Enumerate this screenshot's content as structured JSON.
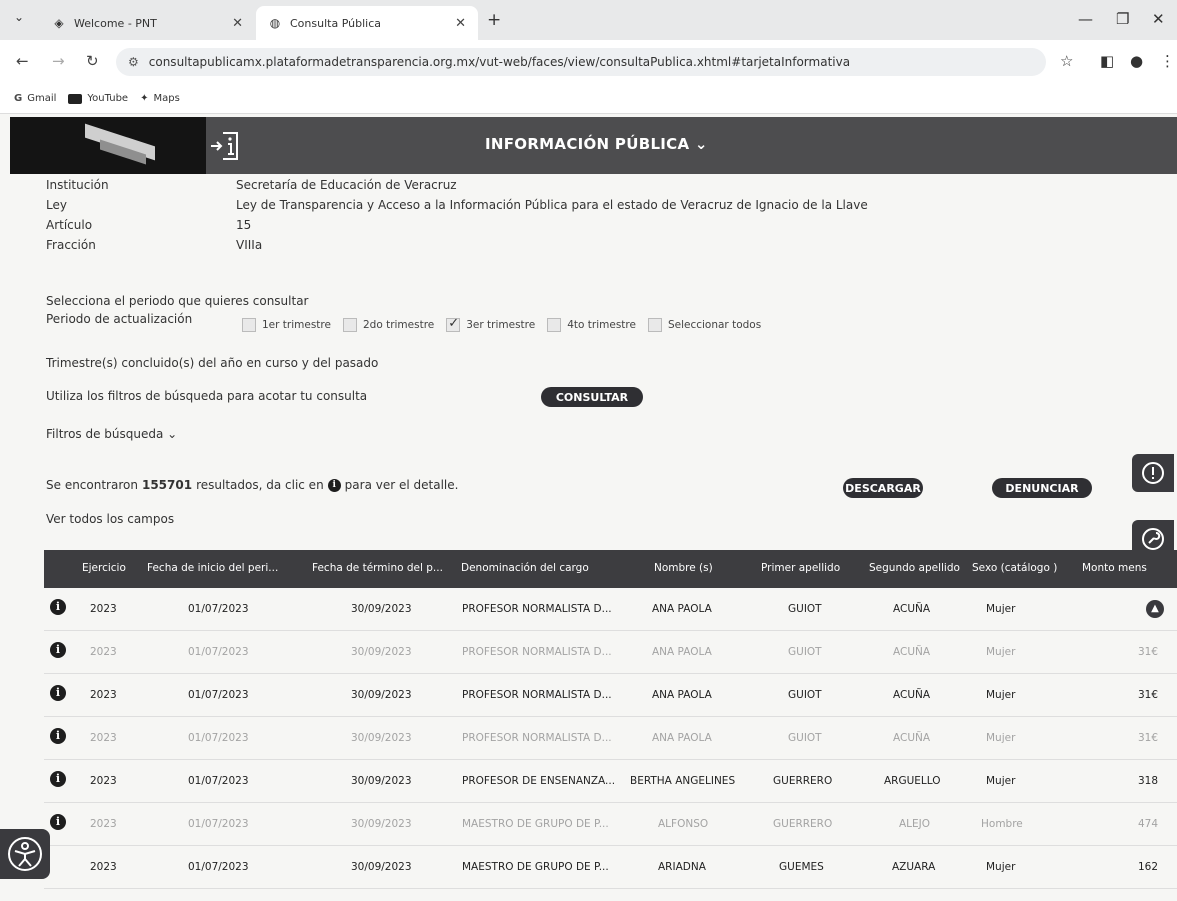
{
  "browser": {
    "tabs": [
      {
        "title": "Welcome - PNT",
        "icon": "compass-icon"
      },
      {
        "title": "Consulta Pública",
        "icon": "globe-icon"
      }
    ],
    "url": "consultapublicamx.plataformadetransparencia.org.mx/vut-web/faces/view/consultaPublica.xhtml#tarjetaInformativa",
    "bookmarks": [
      "Gmail",
      "YouTube",
      "Maps"
    ]
  },
  "header": {
    "title": "INFORMACIÓN PÚBLICA ⌄"
  },
  "meta": {
    "institucion_label": "Institución",
    "institucion_value": "Secretaría de Educación de Veracruz",
    "ley_label": "Ley",
    "ley_value": "Ley de Transparencia y Acceso a la Información Pública para el estado de Veracruz de Ignacio de la Llave",
    "articulo_label": "Artículo",
    "articulo_value": "15",
    "fraccion_label": "Fracción",
    "fraccion_value": "VIIIa"
  },
  "period": {
    "prompt": "Selecciona el periodo que quieres consultar",
    "label": "Periodo de actualización",
    "options": [
      {
        "label": "1er trimestre",
        "checked": false
      },
      {
        "label": "2do trimestre",
        "checked": false
      },
      {
        "label": "3er trimestre",
        "checked": true
      },
      {
        "label": "4to trimestre",
        "checked": false
      },
      {
        "label": "Seleccionar todos",
        "checked": false
      }
    ],
    "note": "Trimestre(s) concluido(s) del año en curso y del pasado"
  },
  "search": {
    "hint": "Utiliza los filtros de búsqueda para acotar tu consulta",
    "consultar": "CONSULTAR",
    "filters": "Filtros de búsqueda ⌄"
  },
  "results": {
    "prefix": "Se encontraron",
    "count": "155701",
    "suffix": "resultados, da clic en",
    "suffix2": "para ver el detalle.",
    "descargar": "DESCARGAR",
    "denunciar": "DENUNCIAR",
    "ver_todos": "Ver todos los campos"
  },
  "table": {
    "headers": [
      "Ejercicio",
      "Fecha de inicio del peri...",
      "Fecha de término del p...",
      "Denominación del cargo",
      "Nombre (s)",
      "Primer apellido",
      "Segundo apellido",
      "Sexo (catálogo )",
      "Monto mens"
    ],
    "rows": [
      [
        "2023",
        "01/07/2023",
        "30/09/2023",
        "PROFESOR NORMALISTA D...",
        "ANA PAOLA",
        "GUIOT",
        "ACUÑA",
        "Mujer",
        ""
      ],
      [
        "2023",
        "01/07/2023",
        "30/09/2023",
        "PROFESOR NORMALISTA D...",
        "ANA PAOLA",
        "GUIOT",
        "ACUÑA",
        "Mujer",
        "31€"
      ],
      [
        "2023",
        "01/07/2023",
        "30/09/2023",
        "PROFESOR NORMALISTA D...",
        "ANA PAOLA",
        "GUIOT",
        "ACUÑA",
        "Mujer",
        "31€"
      ],
      [
        "2023",
        "01/07/2023",
        "30/09/2023",
        "PROFESOR NORMALISTA D...",
        "ANA PAOLA",
        "GUIOT",
        "ACUÑA",
        "Mujer",
        "31€"
      ],
      [
        "2023",
        "01/07/2023",
        "30/09/2023",
        "PROFESOR DE ENSENANZA...",
        "BERTHA ANGELINES",
        "GUERRERO",
        "ARGUELLO",
        "Mujer",
        "318"
      ],
      [
        "2023",
        "01/07/2023",
        "30/09/2023",
        "MAESTRO DE GRUPO DE P...",
        "ALFONSO",
        "GUERRERO",
        "ALEJO",
        "Hombre",
        "474"
      ],
      [
        "2023",
        "01/07/2023",
        "30/09/2023",
        "MAESTRO DE GRUPO DE P...",
        "ARIADNA",
        "GUEMES",
        "AZUARA",
        "Mujer",
        "162"
      ]
    ]
  }
}
